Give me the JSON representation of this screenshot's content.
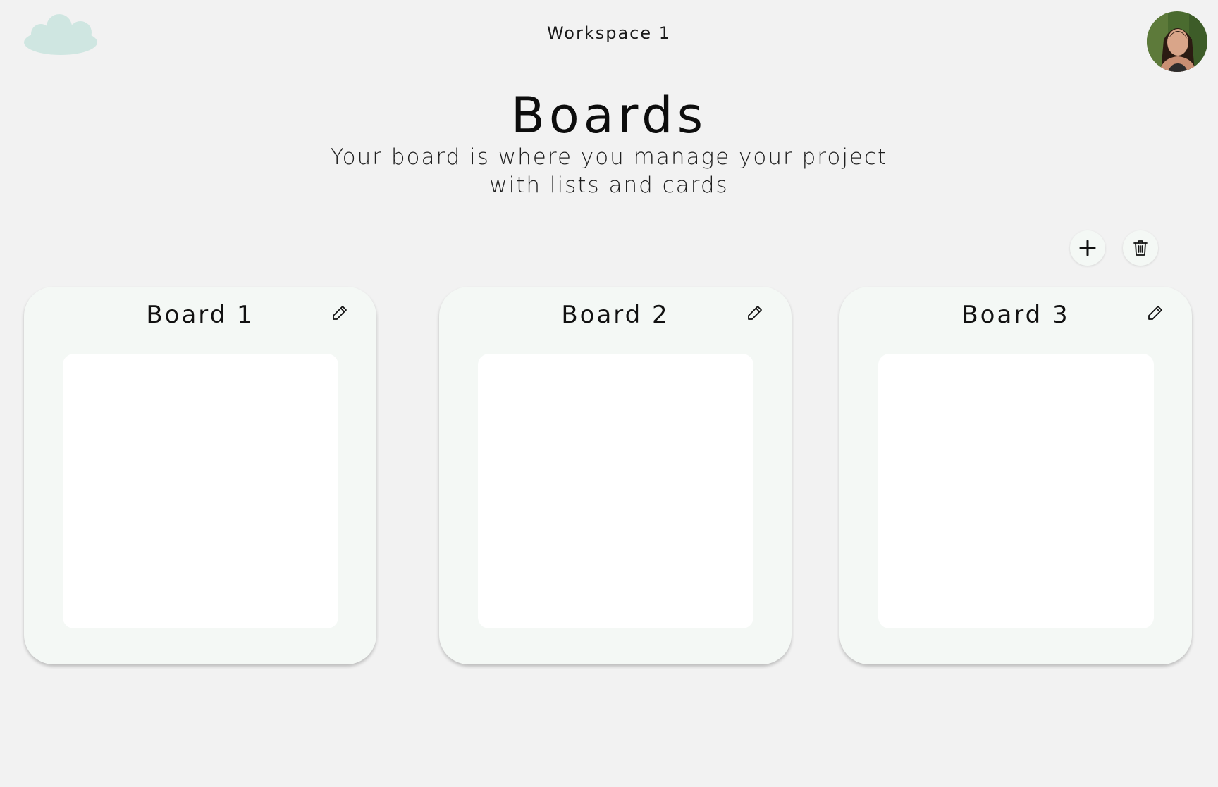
{
  "header": {
    "workspace_title": "Workspace 1",
    "logo_icon": "cloud-icon",
    "avatar_icon": "user-avatar-photo"
  },
  "main": {
    "title": "Boards",
    "subtitle": "Your board is where you manage your project with lists and cards"
  },
  "toolbar": {
    "add_icon": "plus-icon",
    "delete_icon": "trash-icon"
  },
  "boards": [
    {
      "name": "Board 1",
      "edit_icon": "pencil-icon"
    },
    {
      "name": "Board 2",
      "edit_icon": "pencil-icon"
    },
    {
      "name": "Board 3",
      "edit_icon": "pencil-icon"
    }
  ],
  "colors": {
    "background": "#f2f2f2",
    "card": "#f4f8f5",
    "preview": "#ffffff",
    "logo": "#cfe6e1",
    "text": "#111111"
  }
}
